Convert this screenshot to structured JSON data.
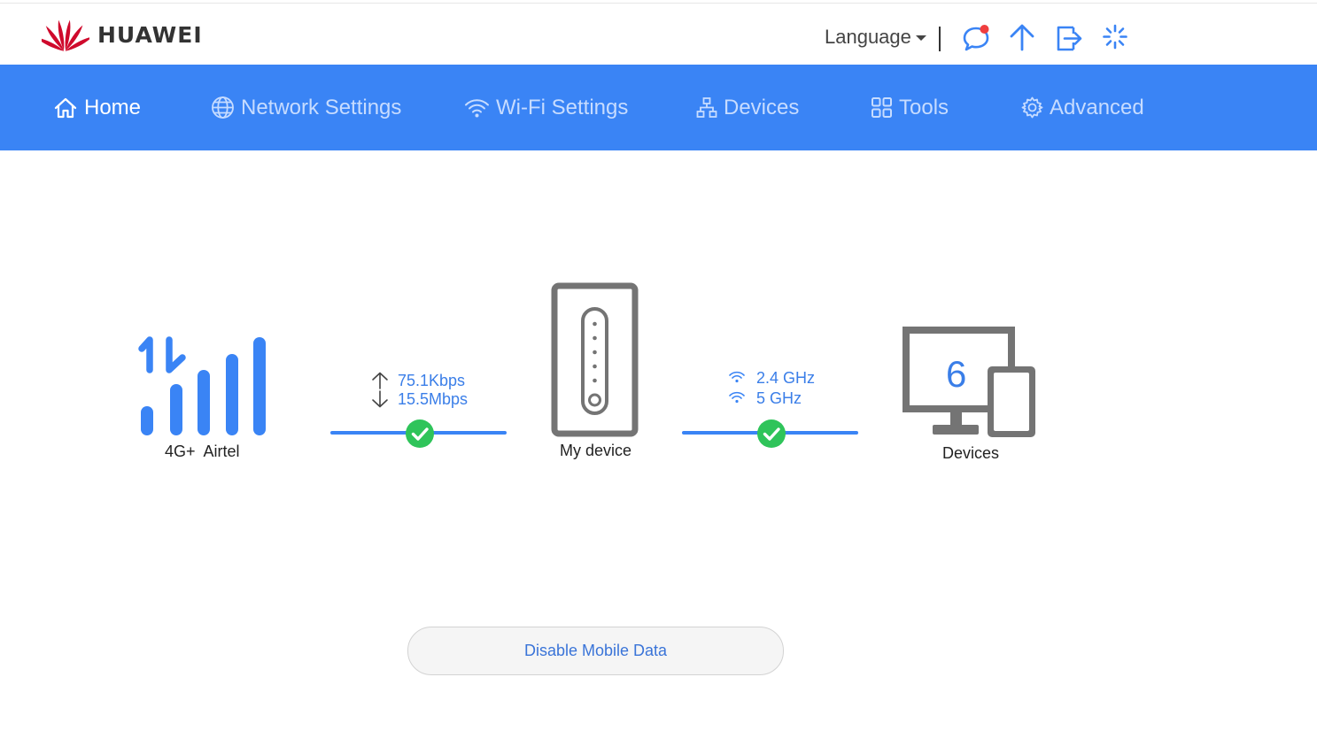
{
  "brand": {
    "name": "HUAWEI",
    "color": "#cf0a2c"
  },
  "header": {
    "language_label": "Language",
    "icons": [
      "message-icon",
      "upload-arrow-icon",
      "logout-icon",
      "loading-spinner-icon"
    ]
  },
  "nav": {
    "items": [
      {
        "label": "Home",
        "icon": "home-icon",
        "active": true
      },
      {
        "label": "Network Settings",
        "icon": "globe-icon",
        "active": false
      },
      {
        "label": "Wi-Fi Settings",
        "icon": "wifi-icon",
        "active": false
      },
      {
        "label": "Devices",
        "icon": "network-tree-icon",
        "active": false
      },
      {
        "label": "Tools",
        "icon": "grid-icon",
        "active": false
      },
      {
        "label": "Advanced",
        "icon": "gear-icon",
        "active": false
      }
    ]
  },
  "status": {
    "network_type": "4G+",
    "operator": "Airtel",
    "upload_speed": "75.1Kbps",
    "download_speed": "15.5Mbps",
    "router_label": "My device",
    "wifi_bands": [
      "2.4 GHz",
      "5 GHz"
    ],
    "device_count": "6",
    "devices_label": "Devices"
  },
  "actions": {
    "disable_mobile_data": "Disable Mobile Data"
  },
  "colors": {
    "accent": "#3a84f5",
    "ok": "#2fc45a",
    "device_gray": "#747474"
  }
}
